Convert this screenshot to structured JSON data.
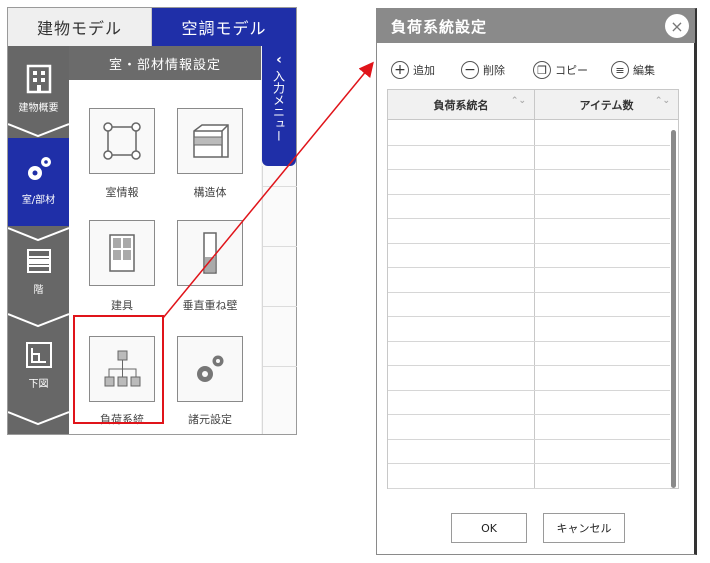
{
  "top_tabs": {
    "building": "建物モデル",
    "aircon": "空調モデル"
  },
  "side_nav": [
    {
      "label": "建物概要",
      "icon": "building-icon"
    },
    {
      "label": "室/部材",
      "icon": "gears-icon"
    },
    {
      "label": "階",
      "icon": "floors-icon"
    },
    {
      "label": "下図",
      "icon": "floorplan-icon"
    }
  ],
  "panel_header": "室・部材情報設定",
  "input_menu": {
    "chevron": "‹",
    "label": "入力メニュー"
  },
  "tiles": [
    {
      "label": "室情報",
      "icon": "room-info-icon"
    },
    {
      "label": "構造体",
      "icon": "structure-icon"
    },
    {
      "label": "建具",
      "icon": "fitting-icon"
    },
    {
      "label": "垂直重ね壁",
      "icon": "vertical-wall-icon"
    },
    {
      "label": "負荷系統",
      "icon": "load-system-icon"
    },
    {
      "label": "諸元設定",
      "icon": "spec-settings-icon"
    }
  ],
  "dialog": {
    "title": "負荷系統設定",
    "close": "×",
    "toolbar": {
      "add": "追加",
      "add_icon": "+",
      "delete": "削除",
      "delete_icon": "−",
      "copy": "コピー",
      "copy_icon": "❐",
      "edit": "編集",
      "edit_icon": "≡"
    },
    "columns": [
      "負荷系統名",
      "アイテム数"
    ],
    "sort_icon": "⌃⌄",
    "ok": "OK",
    "cancel": "キャンセル"
  },
  "colors": {
    "accent": "#1f2fa8",
    "highlight": "#e0141a",
    "panel_gray": "#676767"
  }
}
